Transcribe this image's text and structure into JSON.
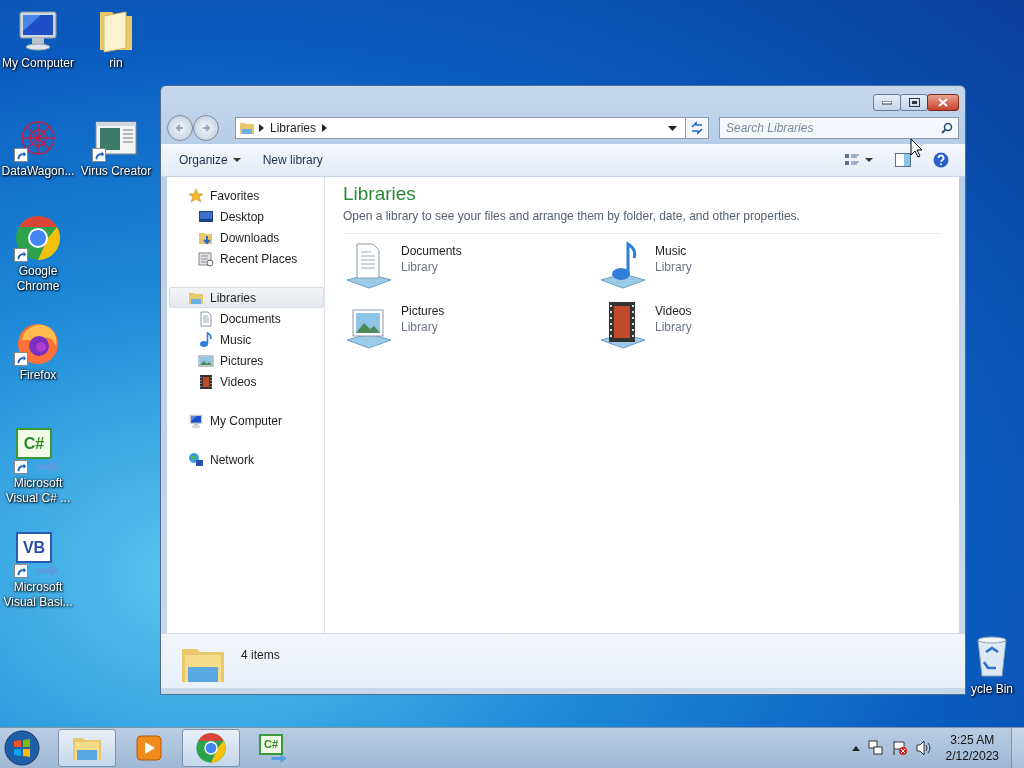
{
  "desktop_icons": [
    {
      "label": "My Computer",
      "kind": "computer",
      "shortcut": false
    },
    {
      "label": "rin",
      "kind": "folder",
      "shortcut": false
    },
    {
      "label": "DataWagon...",
      "kind": "web",
      "shortcut": true
    },
    {
      "label": "Virus Creator",
      "kind": "app",
      "shortcut": true
    },
    {
      "label": "Google Chrome",
      "kind": "chrome",
      "shortcut": true
    },
    {
      "label": "Firefox",
      "kind": "firefox",
      "shortcut": true
    },
    {
      "label": "Microsoft Visual C# ...",
      "kind": "csharp",
      "glyph": "C#",
      "shortcut": true
    },
    {
      "label": "Microsoft Visual Basi...",
      "kind": "vb",
      "glyph": "VB",
      "shortcut": true
    },
    {
      "label": "ycle Bin",
      "kind": "recycle",
      "shortcut": false
    }
  ],
  "window": {
    "address": {
      "crumb": "Libraries"
    },
    "search": {
      "placeholder": "Search Libraries"
    },
    "toolbar": [
      {
        "label": "Organize",
        "dropdown": true
      },
      {
        "label": "New library",
        "dropdown": false
      }
    ],
    "nav": [
      {
        "label": "Favorites",
        "kind": "star",
        "selected": false,
        "children": [
          {
            "label": "Desktop",
            "kind": "desktop",
            "selected": false
          },
          {
            "label": "Downloads",
            "kind": "downloads",
            "selected": false
          },
          {
            "label": "Recent Places",
            "kind": "recent",
            "selected": false
          }
        ]
      },
      {
        "label": "Libraries",
        "kind": "library",
        "selected": true,
        "children": [
          {
            "label": "Documents",
            "kind": "documents",
            "selected": false
          },
          {
            "label": "Music",
            "kind": "music",
            "selected": false
          },
          {
            "label": "Pictures",
            "kind": "pictures",
            "selected": false
          },
          {
            "label": "Videos",
            "kind": "videos",
            "selected": false
          }
        ]
      },
      {
        "label": "My Computer",
        "kind": "computer",
        "selected": false
      },
      {
        "label": "Network",
        "kind": "network",
        "selected": false
      }
    ],
    "content": {
      "title": "Libraries",
      "description": "Open a library to see your files and arrange them by folder, date, and other properties.",
      "items": [
        {
          "name": "Documents",
          "type": "Library",
          "kind": "documents"
        },
        {
          "name": "Music",
          "type": "Library",
          "kind": "music"
        },
        {
          "name": "Pictures",
          "type": "Library",
          "kind": "pictures"
        },
        {
          "name": "Videos",
          "type": "Library",
          "kind": "videos"
        }
      ]
    },
    "status": "4 items"
  },
  "taskbar": {
    "buttons": [
      {
        "kind": "explorer",
        "active": true
      },
      {
        "kind": "media",
        "active": false
      },
      {
        "kind": "chrome",
        "active": true
      },
      {
        "kind": "csharp",
        "glyph": "C#",
        "active": false
      }
    ],
    "time": "3:25 AM",
    "date": "2/12/2023"
  }
}
